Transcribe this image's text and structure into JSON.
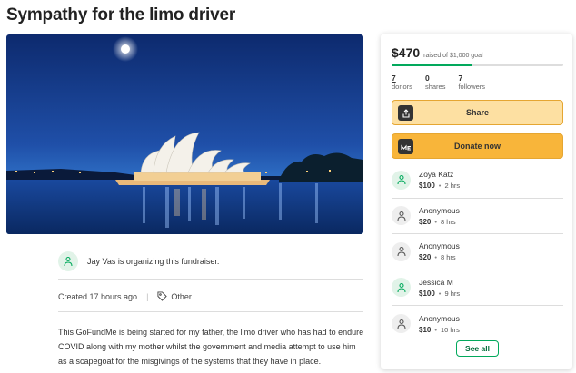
{
  "page": {
    "title": "Sympathy for the limo driver"
  },
  "organizer": {
    "text": "Jay Vas is organizing this fundraiser."
  },
  "meta": {
    "created": "Created 17 hours ago",
    "separator": "|",
    "category": "Other"
  },
  "story": {
    "text": "This GoFundMe is being started for my father, the limo driver who has had to endure COVID along with my mother whilst the government and media attempt to use him as a scapegoat for the misgivings of the systems that they have in place."
  },
  "campaign": {
    "raised": "$470",
    "goal_text": "raised of $1,000 goal",
    "progress_fraction": 0.47,
    "stats": [
      {
        "value": "7",
        "label": "donors"
      },
      {
        "value": "0",
        "label": "shares"
      },
      {
        "value": "7",
        "label": "followers"
      }
    ],
    "share_label": "Share",
    "donate_label": "Donate now",
    "see_all_label": "See all"
  },
  "donors": [
    {
      "name": "Zoya Katz",
      "amount": "$100",
      "time": "2 hrs",
      "avatar": "green"
    },
    {
      "name": "Anonymous",
      "amount": "$20",
      "time": "8 hrs",
      "avatar": "gray"
    },
    {
      "name": "Anonymous",
      "amount": "$20",
      "time": "8 hrs",
      "avatar": "gray"
    },
    {
      "name": "Jessica M",
      "amount": "$100",
      "time": "9 hrs",
      "avatar": "green"
    },
    {
      "name": "Anonymous",
      "amount": "$10",
      "time": "10 hrs",
      "avatar": "gray"
    }
  ],
  "colors": {
    "accent_green": "#02a95c",
    "share_bg": "#fde0a2",
    "donate_bg": "#f8b53a"
  },
  "icons": {
    "organizer": "user-heart-icon",
    "category": "tag-icon",
    "share": "share-upload-icon",
    "donate": "gofundme-me-icon"
  }
}
